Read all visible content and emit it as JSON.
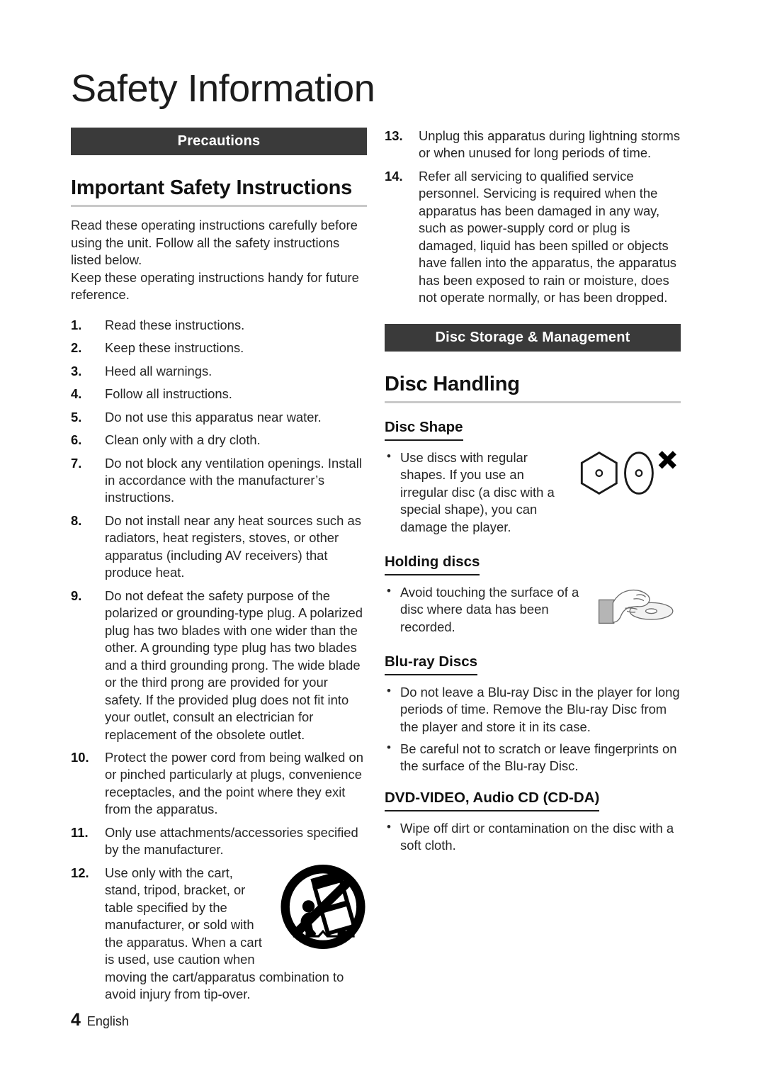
{
  "document": {
    "title": "Safety Information"
  },
  "left_column": {
    "section_bar": "Precautions",
    "heading": "Important Safety Instructions",
    "intro_paragraph_1": "Read these operating instructions carefully before using the unit. Follow all the safety instructions listed below.",
    "intro_paragraph_2": "Keep these operating instructions handy for future reference.",
    "items": [
      {
        "num": "1.",
        "text": "Read these instructions."
      },
      {
        "num": "2.",
        "text": "Keep these instructions."
      },
      {
        "num": "3.",
        "text": "Heed all warnings."
      },
      {
        "num": "4.",
        "text": "Follow all instructions."
      },
      {
        "num": "5.",
        "text": "Do not use this apparatus near water."
      },
      {
        "num": "6.",
        "text": "Clean only with a dry cloth."
      },
      {
        "num": "7.",
        "text": "Do not block any ventilation openings. Install in accordance with the manufacturer’s instructions."
      },
      {
        "num": "8.",
        "text": "Do not install near any heat sources such as radiators, heat registers, stoves, or other apparatus (including AV receivers) that produce heat."
      },
      {
        "num": "9.",
        "text": "Do not defeat the safety purpose of the polarized or grounding-type plug. A polarized plug has two blades with one wider than the other. A grounding type plug has two blades and a third grounding prong. The wide blade or the third prong are provided for your safety. If the provided plug does not fit into your outlet, consult an electrician for replacement of the obsolete outlet."
      },
      {
        "num": "10.",
        "text": "Protect the power cord from being walked on or pinched particularly at plugs, convenience receptacles, and the point where they exit from the apparatus."
      },
      {
        "num": "11.",
        "text": "Only use attachments/accessories specified by the manufacturer."
      },
      {
        "num": "12.",
        "text": "Use only with the cart, stand, tripod, bracket, or table specified by the manufacturer, or sold with the apparatus. When a cart is used, use caution when moving the cart/apparatus combination to avoid injury from tip-over."
      }
    ]
  },
  "right_column": {
    "items_continued": [
      {
        "num": "13.",
        "text": "Unplug this apparatus during lightning storms or when unused for long periods of time."
      },
      {
        "num": "14.",
        "text": "Refer all servicing to qualified service personnel. Servicing is required when the apparatus has been damaged in any way, such as power-supply cord or plug is damaged, liquid has been spilled or objects have fallen into the apparatus, the apparatus has been exposed to rain or moisture, does not operate normally, or has been dropped."
      }
    ],
    "section_bar": "Disc Storage & Management",
    "heading": "Disc Handling",
    "subsections": [
      {
        "title": "Disc Shape",
        "bullets": [
          "Use discs with regular shapes. If you use an irregular disc (a disc with a special shape), you can damage the player."
        ]
      },
      {
        "title": "Holding discs",
        "bullets": [
          "Avoid touching the surface of a disc where data has been recorded."
        ]
      },
      {
        "title": "Blu-ray Discs",
        "bullets": [
          "Do not leave a Blu-ray Disc in the player for long periods of time. Remove the Blu-ray Disc from the player and store it in its case.",
          "Be careful not to scratch or leave fingerprints on the surface of the Blu-ray Disc."
        ]
      },
      {
        "title": "DVD-VIDEO, Audio CD (CD-DA)",
        "bullets": [
          "Wipe off dirt or contamination on the disc with a soft cloth."
        ]
      }
    ]
  },
  "figures": {
    "cart_warning_icon": "no-cart-tipover-icon",
    "hexagon_disc_icon": "hexagon-disc-icon",
    "oval_disc_icon": "oval-disc-icon",
    "x_mark_icon": "x-mark-icon",
    "holding_disc_icon": "hand-holding-disc-icon"
  },
  "footer": {
    "page_number": "4",
    "language": "English"
  },
  "colors": {
    "section_bar_bg": "#3a3a3a",
    "section_bar_text": "#ffffff",
    "heading_rule": "#c9c9c9",
    "body_text": "#262626",
    "page_bg": "#ffffff"
  }
}
